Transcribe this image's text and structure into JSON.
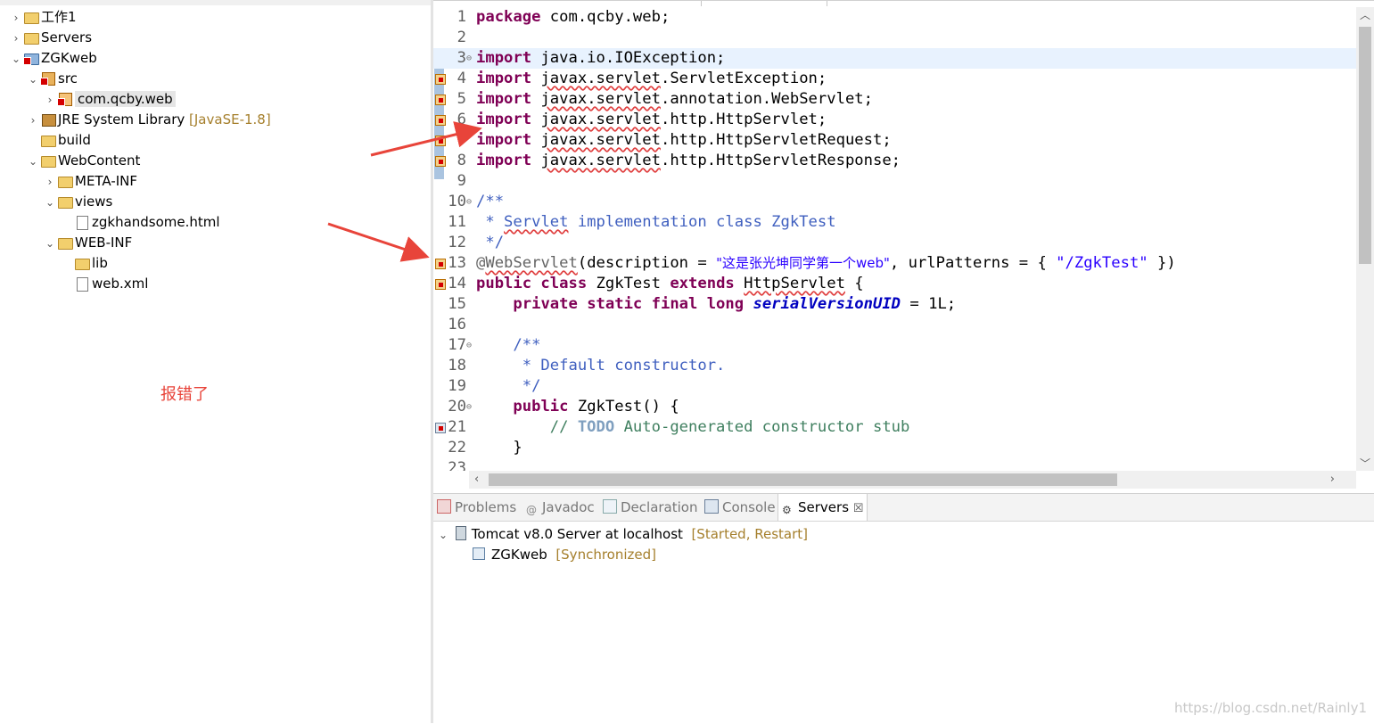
{
  "explorer": {
    "items": [
      {
        "twisty": "›",
        "icon": "folder",
        "label": "工作1",
        "decoration": ""
      },
      {
        "twisty": "›",
        "icon": "folder",
        "label": "Servers",
        "decoration": ""
      },
      {
        "twisty": "⌄",
        "icon": "project",
        "label": "ZGKweb",
        "decoration": ""
      },
      {
        "twisty": "⌄",
        "icon": "src",
        "label": "src",
        "decoration": ""
      },
      {
        "twisty": "›",
        "icon": "package",
        "label": "com.qcby.web",
        "decoration": ""
      },
      {
        "twisty": "›",
        "icon": "jar",
        "label": "JRE System Library",
        "decoration": "[JavaSE-1.8]"
      },
      {
        "twisty": "",
        "icon": "folder",
        "label": "build",
        "decoration": ""
      },
      {
        "twisty": "⌄",
        "icon": "folder",
        "label": "WebContent",
        "decoration": ""
      },
      {
        "twisty": "›",
        "icon": "folder",
        "label": "META-INF",
        "decoration": ""
      },
      {
        "twisty": "⌄",
        "icon": "folder",
        "label": "views",
        "decoration": ""
      },
      {
        "twisty": "",
        "icon": "file",
        "label": "zgkhandsome.html",
        "decoration": ""
      },
      {
        "twisty": "⌄",
        "icon": "folder",
        "label": "WEB-INF",
        "decoration": ""
      },
      {
        "twisty": "",
        "icon": "folder",
        "label": "lib",
        "decoration": ""
      },
      {
        "twisty": "",
        "icon": "file",
        "label": "web.xml",
        "decoration": ""
      }
    ]
  },
  "annotation": "报错了",
  "editor": {
    "line_numbers": [
      "1",
      "2",
      "3",
      "4",
      "5",
      "6",
      "7",
      "8",
      "9",
      "10",
      "11",
      "12",
      "13",
      "14",
      "15",
      "16",
      "17",
      "18",
      "19",
      "20",
      "21",
      "22",
      "23"
    ],
    "code": {
      "l1_kw": "package",
      "l1_rest": " com.qcby.web;",
      "import_kw": "import",
      "l3_rest": " java.io.IOException;",
      "javax_servlet": "javax.servlet",
      "l4_rest": ".ServletException;",
      "l5_rest": ".annotation.WebServlet;",
      "l6_rest": ".http.HttpServlet;",
      "l7_rest": ".http.HttpServletRequest;",
      "l8_rest": ".http.HttpServletResponse;",
      "l10": "/**",
      "l11_star": " * ",
      "l11_servlet": "Servlet",
      "l11_rest": " implementation class ZgkTest",
      "l12": " */",
      "l13_at": "@",
      "l13_ann": "WebServlet",
      "l13_a": "(description = ",
      "l13_s1": "\"这是张光坤同学第一个web\"",
      "l13_b": ", urlPatterns = { ",
      "l13_s2": "\"/ZgkTest\"",
      "l13_c": " })",
      "l14_kw": "public class",
      "l14_a": " ZgkTest ",
      "l14_kw2": "extends",
      "l14_sp": " ",
      "l14_cls": "HttpServlet",
      "l14_b": " {",
      "l15_ind": "    ",
      "l15_kw": "private static final long",
      "l15_sp": " ",
      "l15_fld": "serialVersionUID",
      "l15_b": " = 1L;",
      "l17": "    /**",
      "l18": "     * Default constructor.",
      "l19": "     */",
      "l20_ind": "    ",
      "l20_kw": "public",
      "l20_b": " ZgkTest() {",
      "l21_a": "        // ",
      "l21_todo": "TODO",
      "l21_b": " Auto-generated constructor stub",
      "l22": "    }"
    }
  },
  "panel": {
    "tabs": [
      {
        "label": "Problems",
        "icon": "problems-icon"
      },
      {
        "label": "Javadoc",
        "icon": "javadoc-icon"
      },
      {
        "label": "Declaration",
        "icon": "declaration-icon"
      },
      {
        "label": "Console",
        "icon": "console-icon"
      },
      {
        "label": "Servers",
        "icon": "servers-icon",
        "close": "☒"
      }
    ],
    "server": {
      "label": "Tomcat v8.0 Server at localhost",
      "status": "[Started, Restart]"
    },
    "module": {
      "label": "ZGKweb",
      "status": "[Synchronized]"
    }
  },
  "watermark": "https://blog.csdn.net/Rainly1"
}
